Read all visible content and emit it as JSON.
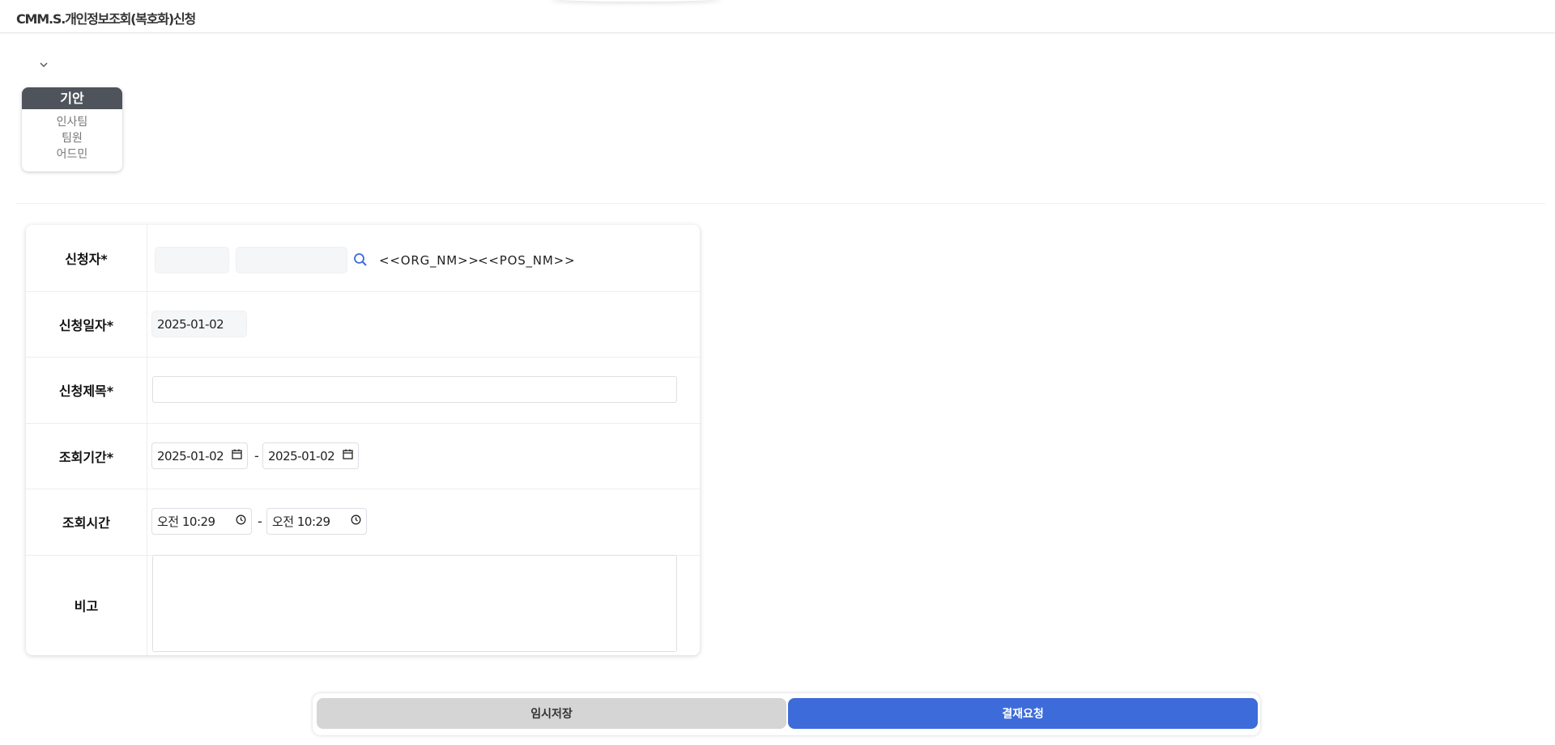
{
  "header": {
    "title": "CMM.S.개인정보조회(복호화)신청"
  },
  "approval": {
    "step_label": "기안",
    "department": "인사팀",
    "position": "팀원",
    "name": "어드민"
  },
  "form": {
    "applicant": {
      "label": "신청자*",
      "id_value": "",
      "name_value": "",
      "org_placeholder": "<<ORG_NM>>",
      "pos_placeholder": "<<POS_NM>>"
    },
    "apply_date": {
      "label": "신청일자*",
      "value": "2025-01-02"
    },
    "title": {
      "label": "신청제목*",
      "value": ""
    },
    "period": {
      "label": "조회기간*",
      "start": "2025-01-02",
      "end": "2025-01-02",
      "separator": "-"
    },
    "time": {
      "label": "조회시간",
      "start": "오전 10:29",
      "end": "오전 10:29",
      "separator": "-"
    },
    "remarks": {
      "label": "비고",
      "value": ""
    }
  },
  "buttons": {
    "temp_save": "임시저장",
    "approval_request": "결재요청"
  },
  "colors": {
    "accent": "#3d6bd9",
    "card_header": "#4f545c",
    "secondary_button": "#d5d5d5"
  },
  "icons": [
    "chevron-down-icon",
    "search-icon",
    "calendar-icon",
    "clock-icon"
  ]
}
